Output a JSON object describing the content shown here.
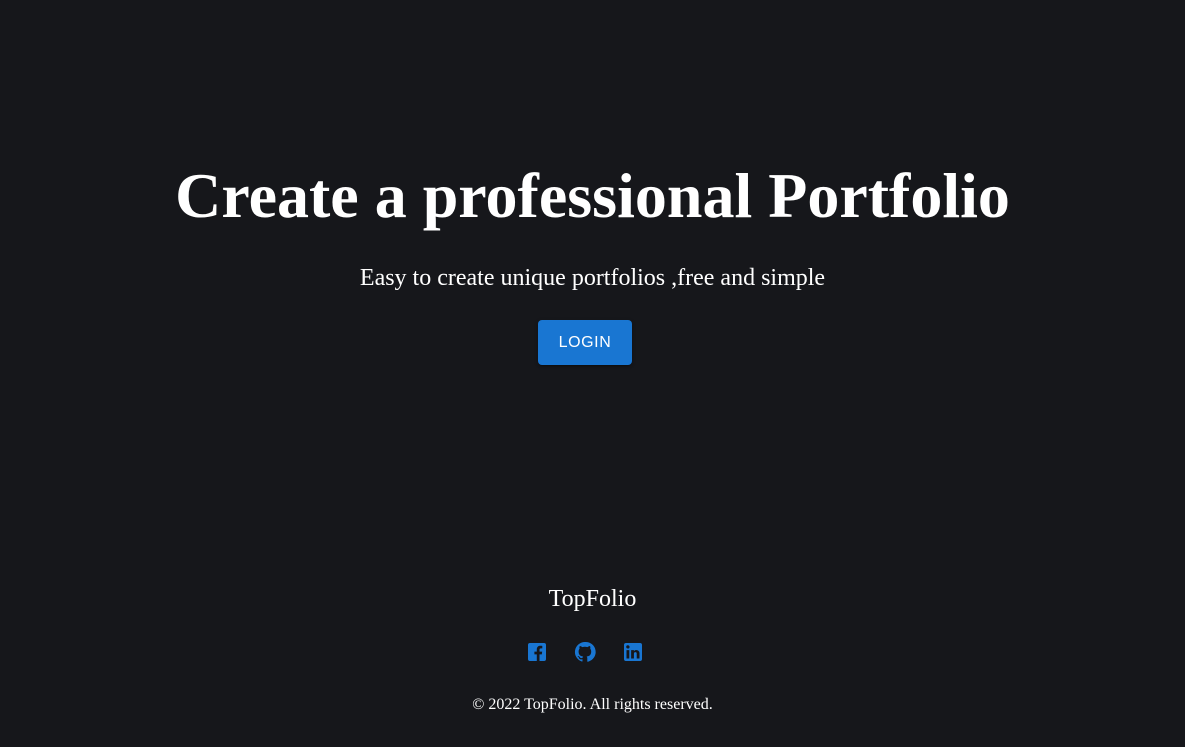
{
  "hero": {
    "title": "Create a professional Portfolio",
    "subtitle": "Easy to create unique portfolios ,free and simple",
    "login_label": "LOGIN"
  },
  "footer": {
    "brand": "TopFolio",
    "social": [
      {
        "icon": "facebook-icon"
      },
      {
        "icon": "github-icon"
      },
      {
        "icon": "linkedin-icon"
      }
    ],
    "copyright": "© 2022 TopFolio. All rights reserved."
  },
  "colors": {
    "background": "#16171b",
    "accent": "#1976d2",
    "text": "#ffffff"
  }
}
